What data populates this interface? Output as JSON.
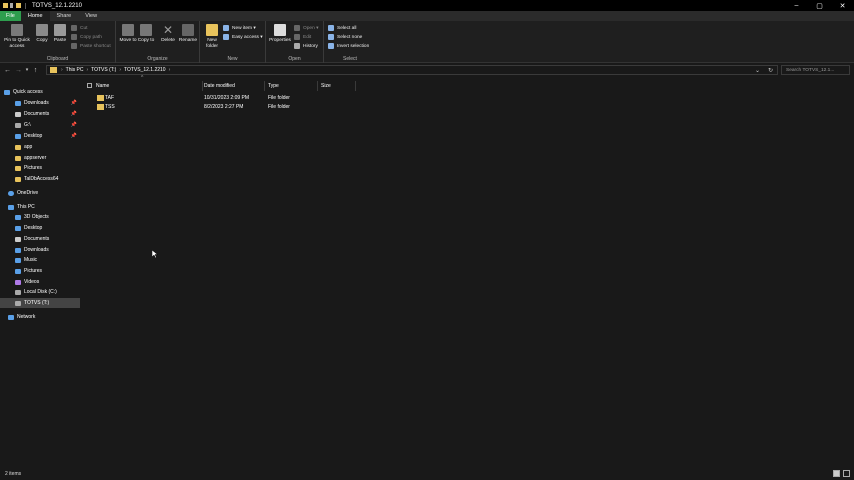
{
  "window": {
    "title": "TOTVS_12.1.2210",
    "controls": {
      "minimize": "–",
      "maximize": "▢",
      "close": "✕"
    }
  },
  "tabs": [
    {
      "label": "File"
    },
    {
      "label": "Home",
      "active": true
    },
    {
      "label": "Share"
    },
    {
      "label": "View"
    }
  ],
  "ribbon": {
    "clipboard": {
      "label": "Clipboard",
      "pin": "Pin to Quick access",
      "copy": "Copy",
      "paste": "Paste",
      "cut": "Cut",
      "copy_path": "Copy path",
      "paste_shortcut": "Paste shortcut"
    },
    "organize": {
      "label": "Organize",
      "move_to": "Move to",
      "copy_to": "Copy to",
      "delete": "Delete",
      "rename": "Rename"
    },
    "new": {
      "label": "New",
      "new_folder": "New folder",
      "new_item": "New item ▾",
      "easy_access": "Easy access ▾"
    },
    "open": {
      "label": "Open",
      "properties": "Properties",
      "open": "Open ▾",
      "edit": "Edit",
      "history": "History"
    },
    "select": {
      "label": "Select",
      "select_all": "Select all",
      "select_none": "Select none",
      "invert": "Invert selection"
    }
  },
  "address": {
    "crumbs": [
      "This PC",
      "TOTVS (T:)",
      "TOTVS_12.1.2210"
    ],
    "search_placeholder": "Search TOTVS_12.1..."
  },
  "nav": {
    "quick_access": "Quick access",
    "quick_items": [
      "Downloads",
      "Documents",
      "G:\\",
      "Desktop",
      "app",
      "appserver",
      "Pictures",
      "TalDbAccess64"
    ],
    "onedrive": "OneDrive",
    "this_pc": "This PC",
    "pc_items": [
      "3D Objects",
      "Desktop",
      "Documents",
      "Downloads",
      "Music",
      "Pictures",
      "Videos",
      "Local Disk (C:)",
      "TOTVS (T:)"
    ],
    "network": "Network"
  },
  "columns": {
    "name": "Name",
    "date": "Date modified",
    "type": "Type",
    "size": "Size"
  },
  "files": [
    {
      "name": "TAF",
      "date": "10/31/2023 2:09 PM",
      "type": "File folder"
    },
    {
      "name": "TSS",
      "date": "8/2/2023 2:27 PM",
      "type": "File folder"
    }
  ],
  "status": {
    "items": "2 items"
  },
  "colors": {
    "accent_file_tab": "#2e9e4e",
    "folder": "#e8c35c",
    "selection": "#444444"
  }
}
